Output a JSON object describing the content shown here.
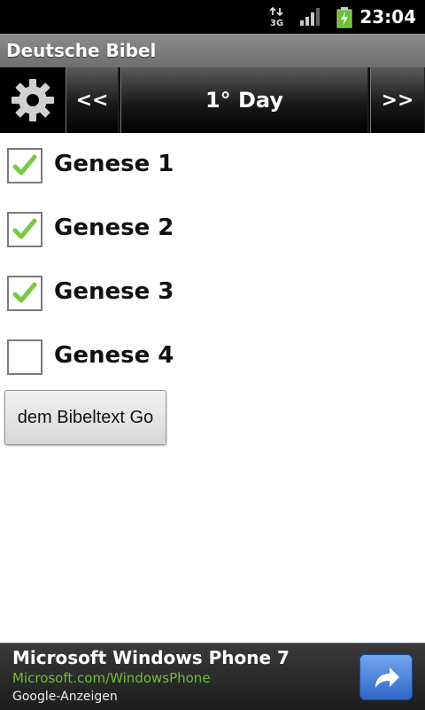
{
  "status_bar": {
    "network": "3G",
    "time": "23:04"
  },
  "app": {
    "title": "Deutsche Bibel"
  },
  "toolbar": {
    "settings_icon": "gear-icon",
    "prev_label": "<<",
    "day_label": "1° Day",
    "next_label": ">>"
  },
  "readings": [
    {
      "label": "Genese 1",
      "checked": true
    },
    {
      "label": "Genese 2",
      "checked": true
    },
    {
      "label": "Genese 3",
      "checked": true
    },
    {
      "label": "Genese 4",
      "checked": false
    }
  ],
  "go_button": {
    "label": "dem Bibeltext Go"
  },
  "ad": {
    "title": "Microsoft Windows Phone 7",
    "url": "Microsoft.com/WindowsPhone",
    "source": "Google-Anzeigen",
    "action_icon": "share-arrow-icon"
  },
  "colors": {
    "check": "#7ac943",
    "ad_url": "#6cbf3b",
    "ad_button": "#3b74d6"
  }
}
